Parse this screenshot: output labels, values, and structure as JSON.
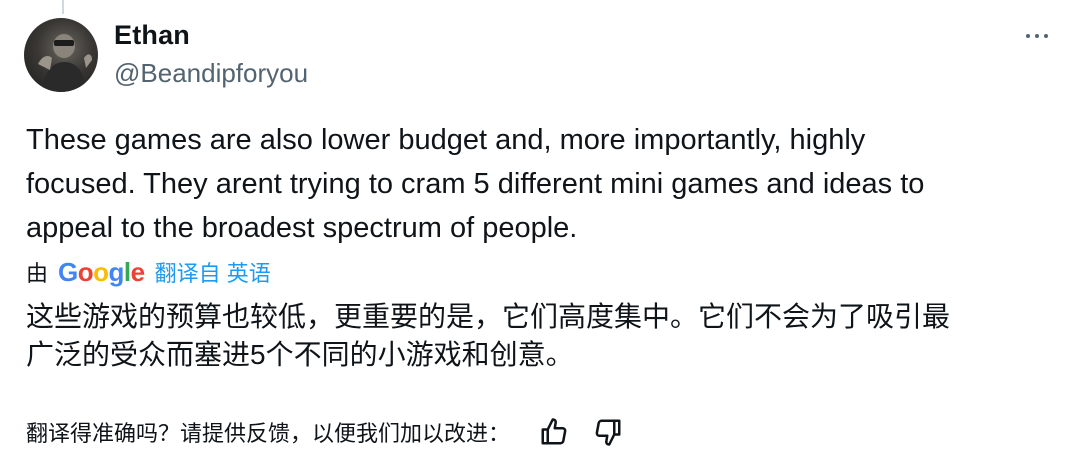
{
  "author": {
    "display_name": "Ethan",
    "handle": "@Beandipforyou"
  },
  "tweet": {
    "text_lines": [
      "These games are also lower budget and, more importantly, highly",
      "focused. They arent trying to cram 5 different mini games and ideas to",
      "appeal to the broadest spectrum of people."
    ]
  },
  "translation": {
    "by_prefix": "由",
    "provider_logo_text": "Google",
    "translated_from": "翻译自 英语",
    "text_lines": [
      "这些游戏的预算也较低，更重要的是，它们高度集中。它们不会为了吸引最",
      "广泛的受众而塞进5个不同的小游戏和创意。"
    ],
    "feedback_prompt": "翻译得准确吗？请提供反馈，以便我们加以改进："
  },
  "icons": {
    "more": "more-horizontal-icon",
    "thumbs_up": "thumbs-up-icon",
    "thumbs_down": "thumbs-down-icon",
    "avatar": "avatar-image"
  },
  "colors": {
    "text_primary": "#0f1419",
    "text_secondary": "#536471",
    "link_blue": "#1d9bf0",
    "google_blue": "#4285f4",
    "google_red": "#ea4335",
    "google_yellow": "#fbbc05",
    "google_green": "#34a853"
  }
}
